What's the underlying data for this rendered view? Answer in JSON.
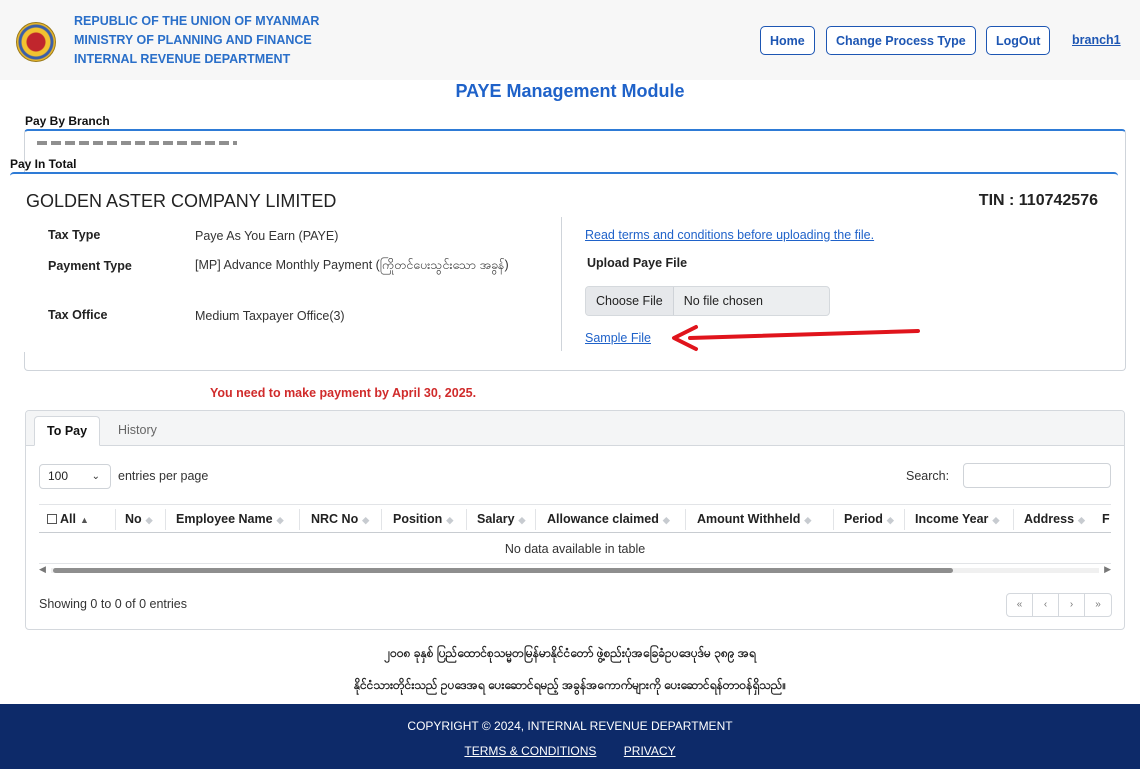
{
  "header": {
    "org_lines": [
      "REPUBLIC OF THE UNION OF MYANMAR",
      "MINISTRY OF PLANNING AND FINANCE",
      "INTERNAL REVENUE DEPARTMENT"
    ],
    "nav": {
      "home": "Home",
      "change_process": "Change Process Type",
      "logout": "LogOut"
    },
    "user": "branch1"
  },
  "page_title": "PAYE Management Module",
  "sections": {
    "pay_by_branch": "Pay By Branch",
    "pay_in_total": "Pay In Total"
  },
  "company": {
    "name": "GOLDEN ASTER COMPANY LIMITED",
    "tin": "TIN : 110742576",
    "fields": [
      {
        "label": "Tax Type",
        "value": "Paye As You Earn (PAYE)"
      },
      {
        "label": "Payment Type",
        "value": "[MP] Advance Monthly Payment (ကြိုတင်ပေးသွင်းသော အခွန်)"
      },
      {
        "label": "Tax Office",
        "value": "Medium Taxpayer Office(3)"
      }
    ]
  },
  "upload": {
    "terms_link": "Read terms and conditions before uploading the file.",
    "title": "Upload Paye File",
    "choose_button": "Choose File",
    "file_status": "No file chosen",
    "sample_link": "Sample File"
  },
  "deadline": "You need to make payment by April 30, 2025.",
  "tabs": [
    "To Pay",
    "History"
  ],
  "table": {
    "entries_value": "100",
    "entries_label": "entries per page",
    "search_label": "Search:",
    "columns": [
      "All",
      "No",
      "Employee Name",
      "NRC No",
      "Position",
      "Salary",
      "Allowance claimed",
      "Amount Withheld",
      "Period",
      "Income Year",
      "Address",
      "F"
    ],
    "empty_message": "No data available in table",
    "showing": "Showing 0 to 0 of 0 entries",
    "pager": [
      "«",
      "‹",
      "›",
      "»"
    ]
  },
  "law_text": [
    "၂၀၀၈ ခုနှစ် ပြည်ထောင်စုသမ္မတမြန်မာနိုင်ငံတော် ဖွဲ့စည်းပုံအခြေခံဥပဒေပုဒ်မ ၃၈၉ အရ",
    "နိုင်ငံသားတိုင်းသည် ဥပဒေအရ ပေးဆောင်ရမည့် အခွန်အကောက်များကို ပေးဆောင်ရန်တာဝန်ရှိသည်။"
  ],
  "footer": {
    "copyright": "COPYRIGHT © 2024, INTERNAL REVENUE DEPARTMENT",
    "links": [
      "TERMS & CONDITIONS",
      "PRIVACY"
    ]
  },
  "colors": {
    "accent": "#1f62c9",
    "footer": "#0d2a69",
    "deadline": "#d02b2b",
    "arrow": "#e0141c"
  }
}
